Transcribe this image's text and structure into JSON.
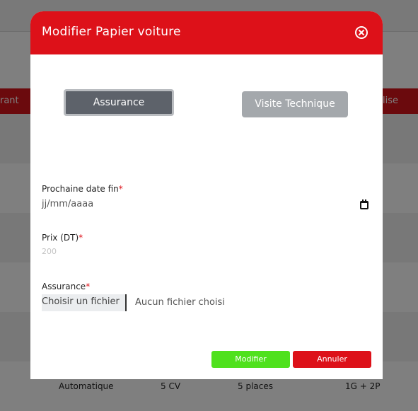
{
  "background": {
    "header_left": "rant",
    "header_right": "lise",
    "last_row": {
      "transmission": "Automatique",
      "power": "5 CV",
      "seats": "5 places",
      "config": "1G + 2P"
    }
  },
  "modal": {
    "title": "Modifier Papier voiture",
    "tabs": {
      "assurance": "Assurance",
      "visite": "Visite Technique"
    },
    "date_field": {
      "label": "Prochaine date fin",
      "required_mark": "*",
      "value": "jj/mm/aaaa"
    },
    "price_field": {
      "label": "Prix (DT)",
      "required_mark": "*",
      "placeholder": "200"
    },
    "file_field": {
      "label": "Assurance",
      "required_mark": "*",
      "button_label": "Choisir un fichier",
      "status": "Aucun fichier choisi"
    },
    "buttons": {
      "submit": "Modifier",
      "cancel": "Annuler"
    }
  },
  "colors": {
    "header_red": "#dd1119",
    "submit_green": "#4fe11d",
    "tab_active": "#5d626a",
    "tab_inactive": "#a4a8ac"
  },
  "icons": {
    "close": "close-circle-icon",
    "calendar": "calendar-icon"
  }
}
